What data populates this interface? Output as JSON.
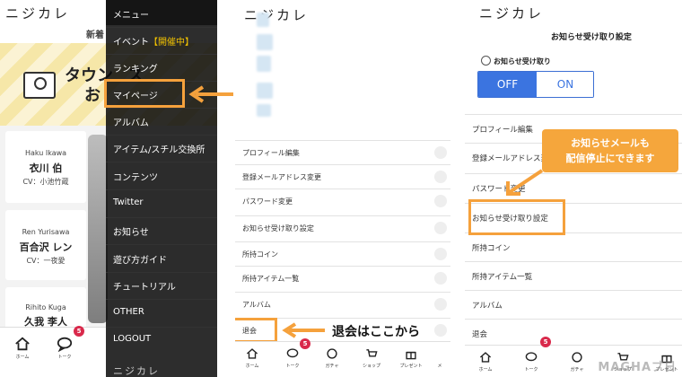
{
  "app": {
    "logo": "ニジカレ"
  },
  "panel1": {
    "new_label": "新着",
    "banner_text_line1": "タウン",
    "banner_text_line1b": "ス",
    "banner_text_line2": "お",
    "characters": [
      {
        "en": "Haku Ikawa",
        "jp": "衣川 伯",
        "cv": "CV：小池竹蔵"
      },
      {
        "en": "Ren Yurisawa",
        "jp": "百合沢 レン",
        "cv": "CV：一夜愛"
      },
      {
        "en": "Rihito Kuga",
        "jp": "久我 李人",
        "cv": ""
      }
    ],
    "drawer": {
      "title": "メニュー",
      "items": [
        {
          "label": "イベント",
          "highlight": "【開催中】"
        },
        {
          "label": "ランキング",
          "highlight": ""
        },
        {
          "label": "マイページ",
          "highlight": ""
        },
        {
          "label": "アルバム",
          "highlight": ""
        },
        {
          "label": "アイテム/スチル交換所",
          "highlight": ""
        },
        {
          "label": "コンテンツ",
          "highlight": ""
        },
        {
          "label": "Twitter",
          "highlight": ""
        },
        {
          "label": "お知らせ",
          "highlight": ""
        },
        {
          "label": "遊び方ガイド",
          "highlight": ""
        },
        {
          "label": "チュートリアル",
          "highlight": ""
        },
        {
          "label": "OTHER",
          "highlight": ""
        },
        {
          "label": "LOGOUT",
          "highlight": ""
        }
      ],
      "footer_logo": "ニジカレ"
    },
    "nav": {
      "home": "ホーム",
      "talk": "トーク",
      "badge": "5"
    }
  },
  "panel2": {
    "menu": [
      "プロフィール編集",
      "登録メールアドレス変更",
      "パスワード変更",
      "お知らせ受け取り設定",
      "所持コイン",
      "所持アイテム一覧",
      "アルバム",
      "退会"
    ],
    "callout": "退会はここから",
    "nav": [
      "ホーム",
      "トーク",
      "ガチャ",
      "ショップ",
      "プレゼント",
      "メ"
    ],
    "badge": "5"
  },
  "panel3": {
    "title": "お知らせ受け取り設定",
    "toggle_label": "お知らせ受け取り",
    "off": "OFF",
    "on": "ON",
    "menu": [
      "プロフィール編集",
      "登録メールアドレス変更",
      "パスワード変更",
      "お知らせ受け取り設定",
      "所持コイン",
      "所持アイテム一覧",
      "アルバム",
      "退会"
    ],
    "note_line1": "お知らせメールも",
    "note_line2": "配信停止にできます",
    "nav": [
      "ホーム",
      "トーク",
      "ガチャ",
      "ショップ",
      "プレゼント"
    ],
    "badge": "5",
    "watermark": "MAGHAブ日"
  },
  "colors": {
    "accent": "#f5a63c",
    "toggle_blue": "#3b74e0",
    "badge": "#d9294b",
    "drawer_bg": "#141414"
  }
}
